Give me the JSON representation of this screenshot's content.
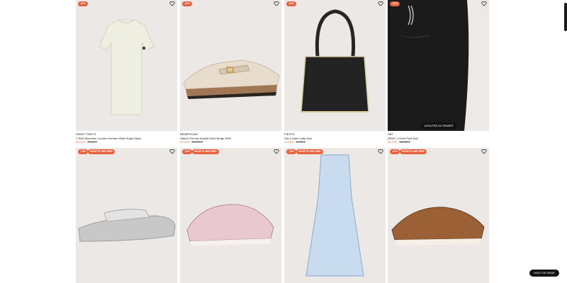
{
  "row1": [
    {
      "badge": "-60%",
      "brand": "SWEET PANTS",
      "name": "T-Shirt Manches Courtes Homme Wash Edge Blanc",
      "price": "35,00 €",
      "old": "69,95 €",
      "image": "cream-tshirt"
    },
    {
      "badge": "-40%",
      "brand": "BEMEROJAN",
      "name": "Sabots Femme Amelia Daim Beige 3920",
      "price": "32,39 €",
      "old": "104,47 €",
      "image": "beige-suede-clog"
    },
    {
      "badge": "-60%",
      "brand": "PIECES",
      "name": "Sac à Main Lydia Noir",
      "price": "10,03 €",
      "old": "29,95 €",
      "image": "black-straw-tote"
    },
    {
      "badge": "-40%",
      "brand": "HBT",
      "name": "ARMY | Chino Pant Noir",
      "price": "36,73 €",
      "old": "112,50 €",
      "image": "black-chino-pant",
      "action": "AJOUTER AU PANIER"
    }
  ],
  "row2": [
    {
      "badge": "-73%",
      "extra": "ROSE PLANS MEN",
      "image": "silver-platform-sandal"
    },
    {
      "badge": "-52%",
      "extra": "ROSE PLANS MEN",
      "image": "pink-metallic-sneaker"
    },
    {
      "badge": "-73%",
      "extra": "ROSE PLANS MEN",
      "image": "blue-zebra-dress"
    },
    {
      "badge": "-47%",
      "extra": "ROSE PLANS MEN",
      "image": "brown-suede-derby"
    }
  ],
  "ui": {
    "back_to_top": "HAUT DE PAGE",
    "heart_icon": "heart-outline-icon"
  }
}
